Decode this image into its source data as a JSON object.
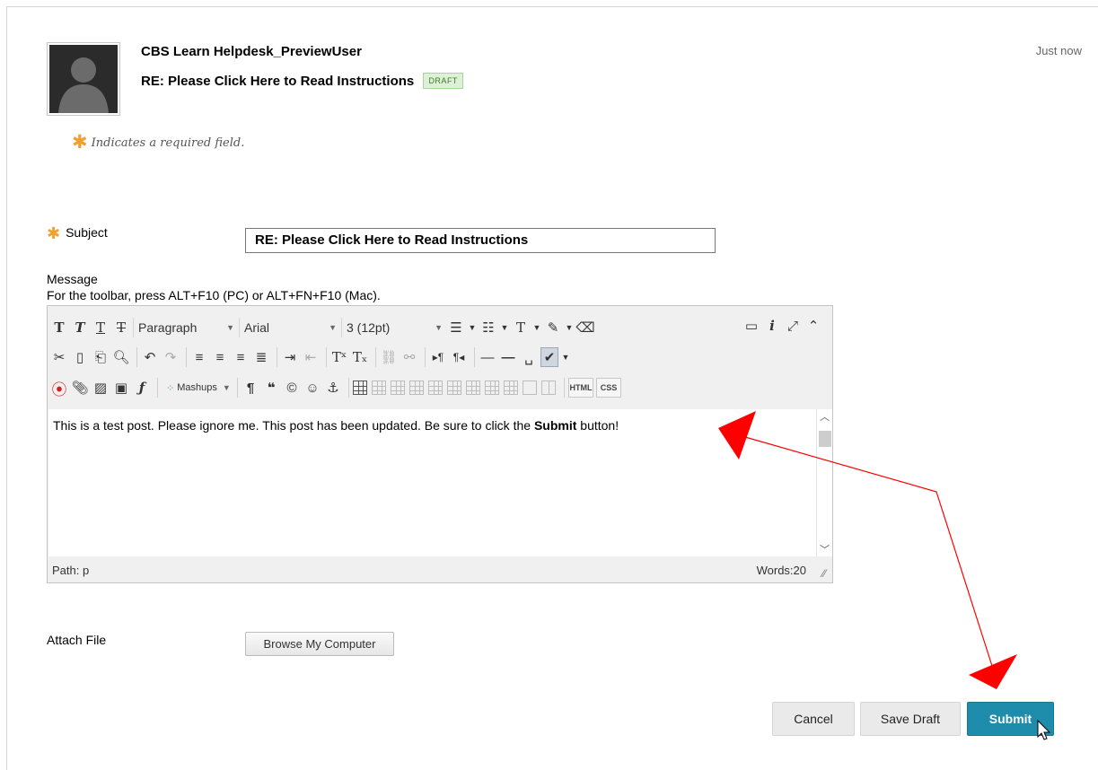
{
  "post": {
    "author": "CBS Learn Helpdesk_PreviewUser",
    "title": "RE: Please Click Here to Read Instructions",
    "badge": "DRAFT",
    "timestamp": "Just now"
  },
  "form": {
    "required_note": "Indicates a required field.",
    "subject_label": "Subject",
    "subject_value": "RE: Please Click Here to Read Instructions",
    "message_label": "Message",
    "toolbar_hint": "For the toolbar, press ALT+F10 (PC) or ALT+FN+F10 (Mac).",
    "attach_label": "Attach File",
    "browse_label": "Browse My Computer"
  },
  "editor": {
    "format_select": "Paragraph",
    "font_select": "Arial",
    "size_select": "3 (12pt)",
    "mashups_label": "Mashups",
    "html_label": "HTML",
    "css_label": "CSS",
    "content_prefix": "This is a test post. Please ignore me. This post has been updated. Be sure to click the ",
    "content_bold": "Submit",
    "content_suffix": " button!",
    "path_label": "Path: p",
    "word_count": "Words:20"
  },
  "actions": {
    "cancel": "Cancel",
    "save_draft": "Save Draft",
    "submit": "Submit"
  },
  "colors": {
    "submit_bg": "#1e8dab",
    "required_star": "#f0a030",
    "draft_badge_bg": "#dff0d8",
    "annotation_arrow": "#ff0000"
  }
}
